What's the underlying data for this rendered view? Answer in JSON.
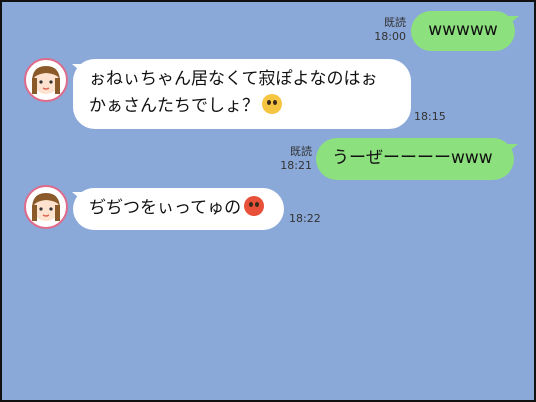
{
  "chat": {
    "messages": [
      {
        "sender": "self",
        "text": "wwwww",
        "read": "既読",
        "time": "18:00"
      },
      {
        "sender": "other",
        "line1": "ぉねぃちゃん居なくて寂ぽよなのはぉ",
        "line2": "かぁさんたちでしょ？",
        "emoji": "pleading-face-icon",
        "time": "18:15"
      },
      {
        "sender": "self",
        "text": "うーぜーーーーwww",
        "read": "既読",
        "time": "18:21"
      },
      {
        "sender": "other",
        "text": "ぢぢつをぃってゅの",
        "emoji": "angry-face-icon",
        "time": "18:22"
      }
    ]
  },
  "colors": {
    "background": "#8aa8d8",
    "outgoing": "#8de07e",
    "incoming": "#ffffff",
    "avatar_border": "#e06a8a"
  }
}
